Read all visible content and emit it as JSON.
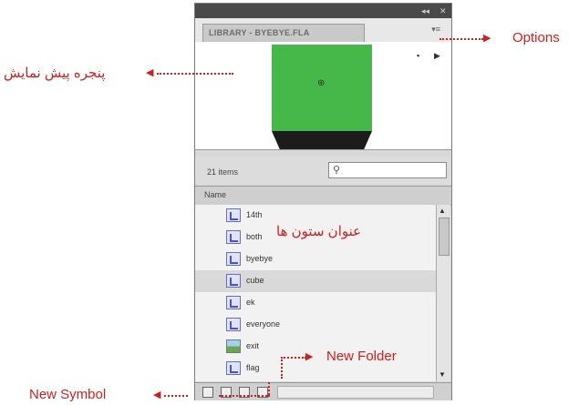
{
  "panel": {
    "tab_title": "LIBRARY - BYEBYE.FLA",
    "item_count": "21 items",
    "column_header": "Name",
    "search": {
      "value": "",
      "placeholder": ""
    },
    "items": [
      {
        "label": "14th",
        "icon": "graphic-symbol-icon",
        "selected": false
      },
      {
        "label": "both",
        "icon": "graphic-symbol-icon",
        "selected": false
      },
      {
        "label": "byebye",
        "icon": "graphic-symbol-icon",
        "selected": false
      },
      {
        "label": "cube",
        "icon": "graphic-symbol-icon",
        "selected": true
      },
      {
        "label": "ek",
        "icon": "graphic-symbol-icon",
        "selected": false
      },
      {
        "label": "everyone",
        "icon": "graphic-symbol-icon",
        "selected": false
      },
      {
        "label": "exit",
        "icon": "bitmap-icon",
        "selected": false
      },
      {
        "label": "flag",
        "icon": "graphic-symbol-icon",
        "selected": false
      }
    ]
  },
  "callouts": {
    "options": "Options",
    "preview_window": "پنجره پیش نمایش",
    "column_titles": "عنوان ستون ها",
    "new_folder": "New Folder",
    "new_symbol": "New Symbol"
  },
  "colors": {
    "callout": "#cc1f1f",
    "preview_green": "#46b84a",
    "titlebar": "#4a4a4a"
  }
}
